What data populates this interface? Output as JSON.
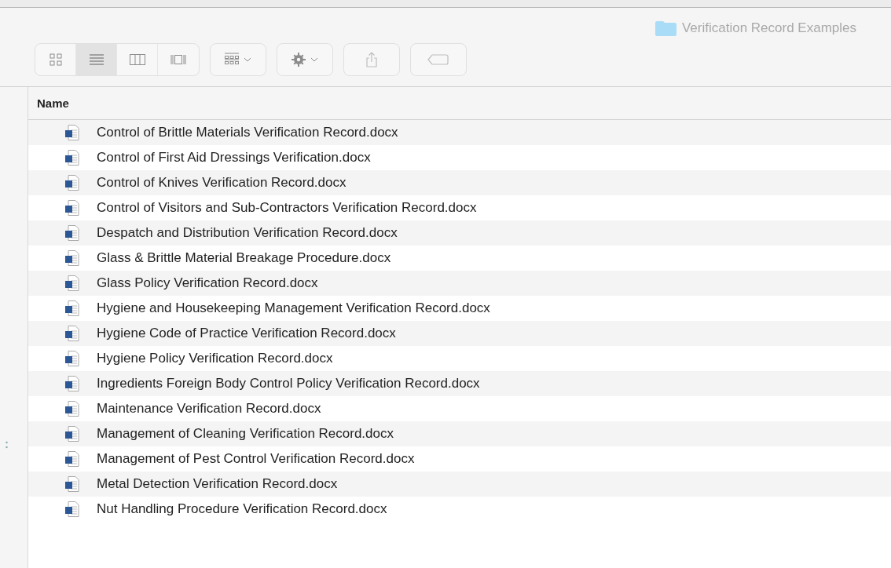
{
  "window": {
    "title": "Verification Record Examples"
  },
  "toolbar": {
    "view_buttons": [
      {
        "kind": "icons",
        "selected": false
      },
      {
        "kind": "list",
        "selected": true
      },
      {
        "kind": "columns",
        "selected": false
      },
      {
        "kind": "gallery",
        "selected": false
      }
    ],
    "buttons": [
      {
        "kind": "arrange"
      },
      {
        "kind": "action"
      },
      {
        "kind": "share"
      },
      {
        "kind": "tags"
      }
    ]
  },
  "table": {
    "columns": [
      "Name"
    ],
    "rows": [
      {
        "name": "Control of Brittle Materials Verification Record.docx"
      },
      {
        "name": "Control of First Aid Dressings Verification.docx"
      },
      {
        "name": "Control of Knives Verification Record.docx"
      },
      {
        "name": "Control of Visitors and Sub-Contractors Verification Record.docx"
      },
      {
        "name": "Despatch and Distribution Verification Record.docx"
      },
      {
        "name": "Glass & Brittle Material Breakage Procedure.docx"
      },
      {
        "name": "Glass Policy Verification Record.docx"
      },
      {
        "name": "Hygiene and Housekeeping Management Verification Record.docx"
      },
      {
        "name": "Hygiene Code of Practice Verification Record.docx"
      },
      {
        "name": "Hygiene Policy Verification Record.docx"
      },
      {
        "name": "Ingredients Foreign Body Control Policy Verification Record.docx"
      },
      {
        "name": "Maintenance Verification Record.docx"
      },
      {
        "name": "Management of Cleaning Verification Record.docx"
      },
      {
        "name": "Management of Pest Control Verification Record.docx"
      },
      {
        "name": "Metal Detection Verification Record.docx"
      },
      {
        "name": "Nut Handling Procedure Verification Record.docx"
      }
    ]
  }
}
